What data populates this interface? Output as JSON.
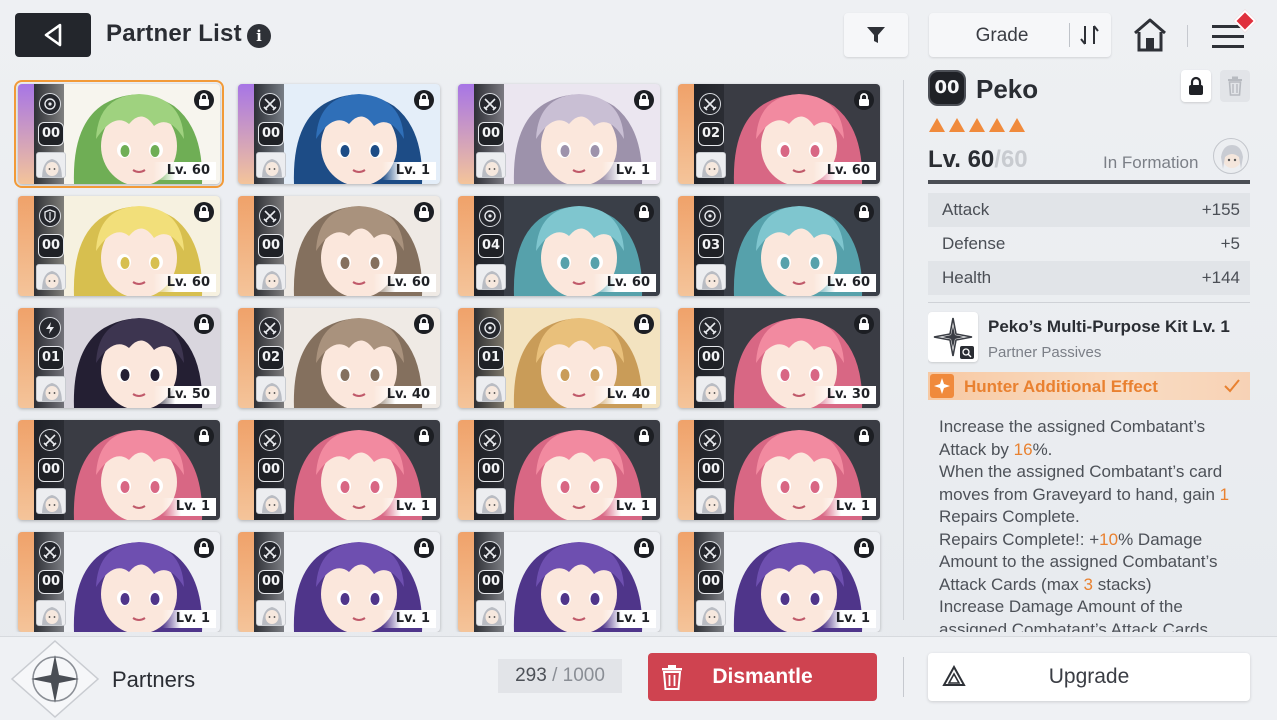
{
  "header": {
    "title": "Partner List",
    "info_glyph": "i",
    "sort_label": "Grade"
  },
  "cards": [
    {
      "grade": "00",
      "level": "Lv. 60",
      "type": "target-icon",
      "selected": true,
      "hair": "#9fd27f",
      "hair_dark": "#6fae55",
      "bg": "#f7f5ee",
      "stripe": "#a775e6"
    },
    {
      "grade": "00",
      "level": "Lv. 1",
      "type": "crossed-swords-icon",
      "selected": false,
      "hair": "#2f6fb8",
      "hair_dark": "#1d4c86",
      "bg": "#e4eef9",
      "stripe": "#a775e6"
    },
    {
      "grade": "00",
      "level": "Lv. 1",
      "type": "crossed-swords-icon",
      "selected": false,
      "hair": "#c9bfd4",
      "hair_dark": "#9d92ab",
      "bg": "#ebe6f0",
      "stripe": "#a775e6"
    },
    {
      "grade": "02",
      "level": "Lv. 60",
      "type": "crossed-swords-icon",
      "selected": false,
      "hair": "#f28aa0",
      "hair_dark": "#d86784",
      "bg": "#3a3c44",
      "stripe": "#f0a26a"
    },
    {
      "grade": "00",
      "level": "Lv. 60",
      "type": "shield-icon",
      "selected": false,
      "hair": "#f2df7a",
      "hair_dark": "#d7bf4f",
      "bg": "#f6f1e0",
      "stripe": "#f0a26a"
    },
    {
      "grade": "00",
      "level": "Lv. 60",
      "type": "crossed-swords-icon",
      "selected": false,
      "hair": "#a9927d",
      "hair_dark": "#84705e",
      "bg": "#efeae5",
      "stripe": "#f0a26a"
    },
    {
      "grade": "04",
      "level": "Lv. 60",
      "type": "target-icon",
      "selected": false,
      "hair": "#7fc6cf",
      "hair_dark": "#56a1ab",
      "bg": "#3a3f48",
      "stripe": "#f0a26a"
    },
    {
      "grade": "03",
      "level": "Lv. 60",
      "type": "target-icon",
      "selected": false,
      "hair": "#7fc6cf",
      "hair_dark": "#56a1ab",
      "bg": "#3a3f48",
      "stripe": "#f0a26a"
    },
    {
      "grade": "01",
      "level": "Lv. 50",
      "type": "lightning-icon",
      "selected": false,
      "hair": "#3d3550",
      "hair_dark": "#241f33",
      "bg": "#d9d6de",
      "stripe": "#f0a26a"
    },
    {
      "grade": "02",
      "level": "Lv. 40",
      "type": "crossed-swords-icon",
      "selected": false,
      "hair": "#a9927d",
      "hair_dark": "#84705e",
      "bg": "#efeae5",
      "stripe": "#f0a26a"
    },
    {
      "grade": "01",
      "level": "Lv. 40",
      "type": "target-icon",
      "selected": false,
      "hair": "#e9c07b",
      "hair_dark": "#c99c58",
      "bg": "#f3e3c0",
      "stripe": "#f0a26a"
    },
    {
      "grade": "00",
      "level": "Lv. 30",
      "type": "crossed-swords-icon",
      "selected": false,
      "hair": "#f28aa0",
      "hair_dark": "#d86784",
      "bg": "#3a3c44",
      "stripe": "#f0a26a"
    },
    {
      "grade": "00",
      "level": "Lv. 1",
      "type": "crossed-swords-icon",
      "selected": false,
      "hair": "#f28aa0",
      "hair_dark": "#d86784",
      "bg": "#3a3c44",
      "stripe": "#f0a26a"
    },
    {
      "grade": "00",
      "level": "Lv. 1",
      "type": "crossed-swords-icon",
      "selected": false,
      "hair": "#f28aa0",
      "hair_dark": "#d86784",
      "bg": "#3a3c44",
      "stripe": "#f0a26a"
    },
    {
      "grade": "00",
      "level": "Lv. 1",
      "type": "crossed-swords-icon",
      "selected": false,
      "hair": "#f28aa0",
      "hair_dark": "#d86784",
      "bg": "#3a3c44",
      "stripe": "#f0a26a"
    },
    {
      "grade": "00",
      "level": "Lv. 1",
      "type": "crossed-swords-icon",
      "selected": false,
      "hair": "#f28aa0",
      "hair_dark": "#d86784",
      "bg": "#3a3c44",
      "stripe": "#f0a26a"
    },
    {
      "grade": "00",
      "level": "Lv. 1",
      "type": "crossed-swords-icon",
      "selected": false,
      "hair": "#6e4fb0",
      "hair_dark": "#4f358a",
      "bg": "#eef0f4",
      "stripe": "#f0a26a"
    },
    {
      "grade": "00",
      "level": "Lv. 1",
      "type": "crossed-swords-icon",
      "selected": false,
      "hair": "#6e4fb0",
      "hair_dark": "#4f358a",
      "bg": "#eef0f4",
      "stripe": "#f0a26a"
    },
    {
      "grade": "00",
      "level": "Lv. 1",
      "type": "crossed-swords-icon",
      "selected": false,
      "hair": "#6e4fb0",
      "hair_dark": "#4f358a",
      "bg": "#eef0f4",
      "stripe": "#f0a26a"
    },
    {
      "grade": "00",
      "level": "Lv. 1",
      "type": "crossed-swords-icon",
      "selected": false,
      "hair": "#6e4fb0",
      "hair_dark": "#4f358a",
      "bg": "#eef0f4",
      "stripe": "#f0a26a"
    }
  ],
  "detail": {
    "grade": "00",
    "name": "Peko",
    "star_count": 5,
    "star_color": "#f08a3c",
    "level_current": "Lv. 60",
    "level_sep": "/",
    "level_max": "60",
    "level_progress": 1.0,
    "formation_label": "In Formation",
    "stats": [
      {
        "label": "Attack",
        "value": "+155"
      },
      {
        "label": "Defense",
        "value": "+5"
      },
      {
        "label": "Health",
        "value": "+144"
      }
    ],
    "skill_name": "Peko’s Multi-Purpose Kit Lv. 1",
    "skill_sub": "Partner Passives",
    "effect_label": "Hunter Additional Effect",
    "desc": {
      "l1a": "Increase the assigned Combatant’s Attack by ",
      "l1b": "16",
      "l1c": "%.",
      "l2a": "When the assigned Combatant’s card moves from Graveyard to hand, gain ",
      "l2b": "1",
      "l2c": " Repairs Complete.",
      "l3a": "Repairs Complete!: +",
      "l3b": "10",
      "l3c": "% Damage Amount to the assigned Combatant’s Attack Cards (max ",
      "l3d": "3",
      "l3e": " stacks)",
      "l4": "Increase Damage Amount of the assigned Combatant’s Attack Cards"
    }
  },
  "bottom": {
    "partners_label": "Partners",
    "count": "293",
    "count_sep": "/",
    "capacity": "1000",
    "dismantle_label": "Dismantle",
    "upgrade_label": "Upgrade"
  },
  "colors": {
    "accent_orange": "#f08a3c",
    "dismantle_red": "#cf4350",
    "selected_outline": "#f29a38"
  }
}
